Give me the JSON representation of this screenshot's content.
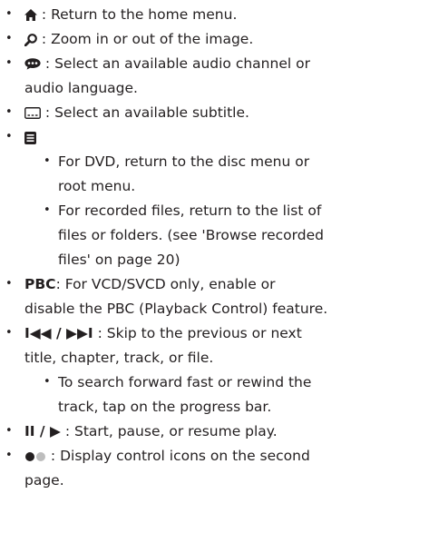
{
  "items": {
    "home": {
      "label": " : Return to the home menu.",
      "icon": "home-icon"
    },
    "zoom": {
      "label": " : Zoom in or out of the image.",
      "icon": "zoom-icon"
    },
    "audio": {
      "line1": " : Select an available audio channel or",
      "line2": "audio language.",
      "icon": "speech-bubble-icon"
    },
    "subtitle": {
      "label": " : Select an available subtitle.",
      "icon": "subtitle-icon"
    },
    "menu": {
      "icon": "menu-list-icon",
      "sub1": {
        "line1": "For DVD, return to the disc menu or",
        "line2": "root menu."
      },
      "sub2": {
        "line1": "For recorded files, return to the list of",
        "line2": "files or folders. (see 'Browse recorded",
        "line3": "files' on page 20)"
      }
    },
    "pbc": {
      "key": "PBC",
      "line1": ": For VCD/SVCD only, enable or",
      "line2": "disable the PBC (Playback Control) feature."
    },
    "skip": {
      "key": "I◀◀ / ▶▶I",
      "line1": " : Skip to the previous or next",
      "line2": "title, chapter, track, or file.",
      "sub1": {
        "line1": "To search forward fast or rewind the",
        "line2": "track, tap on the progress bar."
      }
    },
    "play": {
      "key": "II / ▶",
      "label": " : Start, pause, or resume play."
    },
    "page": {
      "line1": " : Display control icons on the second",
      "line2": "page.",
      "icon": "page-dots-icon"
    }
  },
  "bullet": "•",
  "colors": {
    "text": "#231f20",
    "dot_inactive": "#bdbdbd"
  }
}
